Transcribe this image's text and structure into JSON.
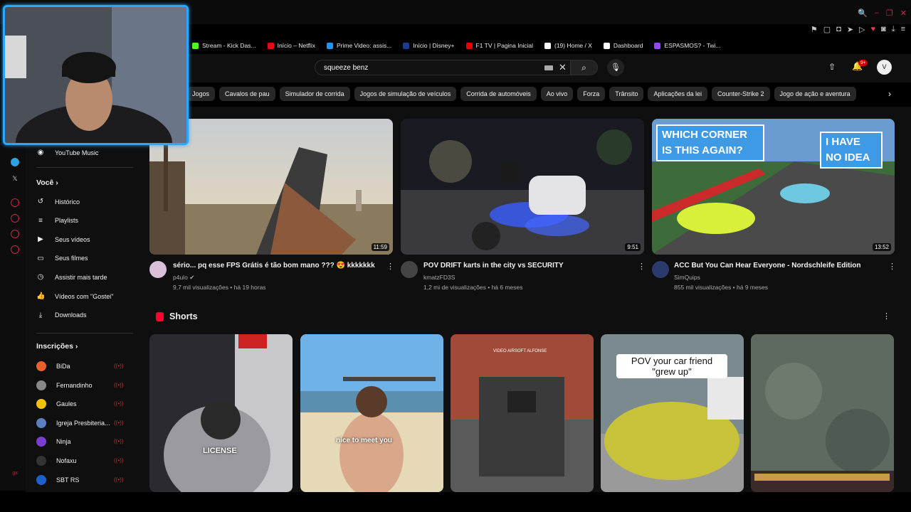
{
  "window": {
    "controls": [
      "🔍",
      "–",
      "❐",
      "✕"
    ]
  },
  "browser_toolbar": {
    "icons": [
      "bookmark-icon",
      "screenshot-icon",
      "shield-icon",
      "send-icon",
      "play-icon",
      "heart-icon",
      "wallet-icon",
      "download-icon",
      "menu-icon"
    ]
  },
  "bookmarks": [
    {
      "label": "Stream - Kick Das...",
      "color": "#53fc18"
    },
    {
      "label": "Início – Netflix",
      "color": "#e50914"
    },
    {
      "label": "Prime Video: assis...",
      "color": "#1a98ff"
    },
    {
      "label": "Início | Disney+",
      "color": "#1d3b8f"
    },
    {
      "label": "F1 TV | Pagina Inicial",
      "color": "#e10600"
    },
    {
      "label": "(19) Home / X",
      "color": "#ffffff"
    },
    {
      "label": "Dashboard",
      "color": "#ffffff"
    },
    {
      "label": "ESPASMOS? - Twi...",
      "color": "#9146ff"
    }
  ],
  "header": {
    "search_value": "squeeze benz",
    "notification_count": "9+",
    "avatar_letter": "V"
  },
  "chips": [
    "Jogos",
    "Cavalos de pau",
    "Simulador de corrida",
    "Jogos de simulação de veículos",
    "Corrida de automóveis",
    "Ao vivo",
    "Forza",
    "Trânsito",
    "Aplicações da lei",
    "Counter-Strike 2",
    "Jogo de ação e aventura"
  ],
  "nav": {
    "youtube_music": "YouTube Music",
    "you_heading": "Você",
    "you_items": [
      "Histórico",
      "Playlists",
      "Seus vídeos",
      "Seus filmes",
      "Assistir mais tarde",
      "Vídeos com \"Gostei\"",
      "Downloads"
    ],
    "subs_heading": "Inscrições",
    "subscriptions": [
      {
        "name": "BiDa",
        "color": "#e8612c",
        "live": true
      },
      {
        "name": "Fernandinho",
        "color": "#888888",
        "live": true
      },
      {
        "name": "Gaules",
        "color": "#f2c200",
        "live": true
      },
      {
        "name": "Igreja Presbiteria...",
        "color": "#5b7fbf",
        "live": true
      },
      {
        "name": "Ninja",
        "color": "#7a3fd1",
        "live": true
      },
      {
        "name": "Nofaxu",
        "color": "#333333",
        "live": true
      },
      {
        "name": "SBT RS",
        "color": "#1e60c9",
        "live": true
      }
    ]
  },
  "videos": [
    {
      "title": "sério... pq esse FPS Grátis é tão bom mano ??? 😍 kkkkkkk",
      "channel": "p4ulo",
      "meta": "9,7 mil visualizações • há 19 horas",
      "duration": "11:59"
    },
    {
      "title": "POV DRIFT karts in the city vs SECURITY",
      "channel": "kmatzFD3S",
      "meta": "1,2 mi de visualizações • há 6 meses",
      "duration": "9:51"
    },
    {
      "title": "ACC But You Can Hear Everyone - Nordschleife Edition",
      "channel": "SimQuips",
      "meta": "855 mil visualizações • há 9 meses",
      "duration": "13:52"
    }
  ],
  "thumb_text": {
    "bubble_left": "WHICH CORNER IS THIS AGAIN?",
    "bubble_right": "I HAVE NO IDEA"
  },
  "shorts": {
    "heading": "Shorts",
    "captions": [
      "LICENSE",
      "nice to meet you",
      "",
      "POV your car friend \"grew up\"",
      ""
    ]
  }
}
